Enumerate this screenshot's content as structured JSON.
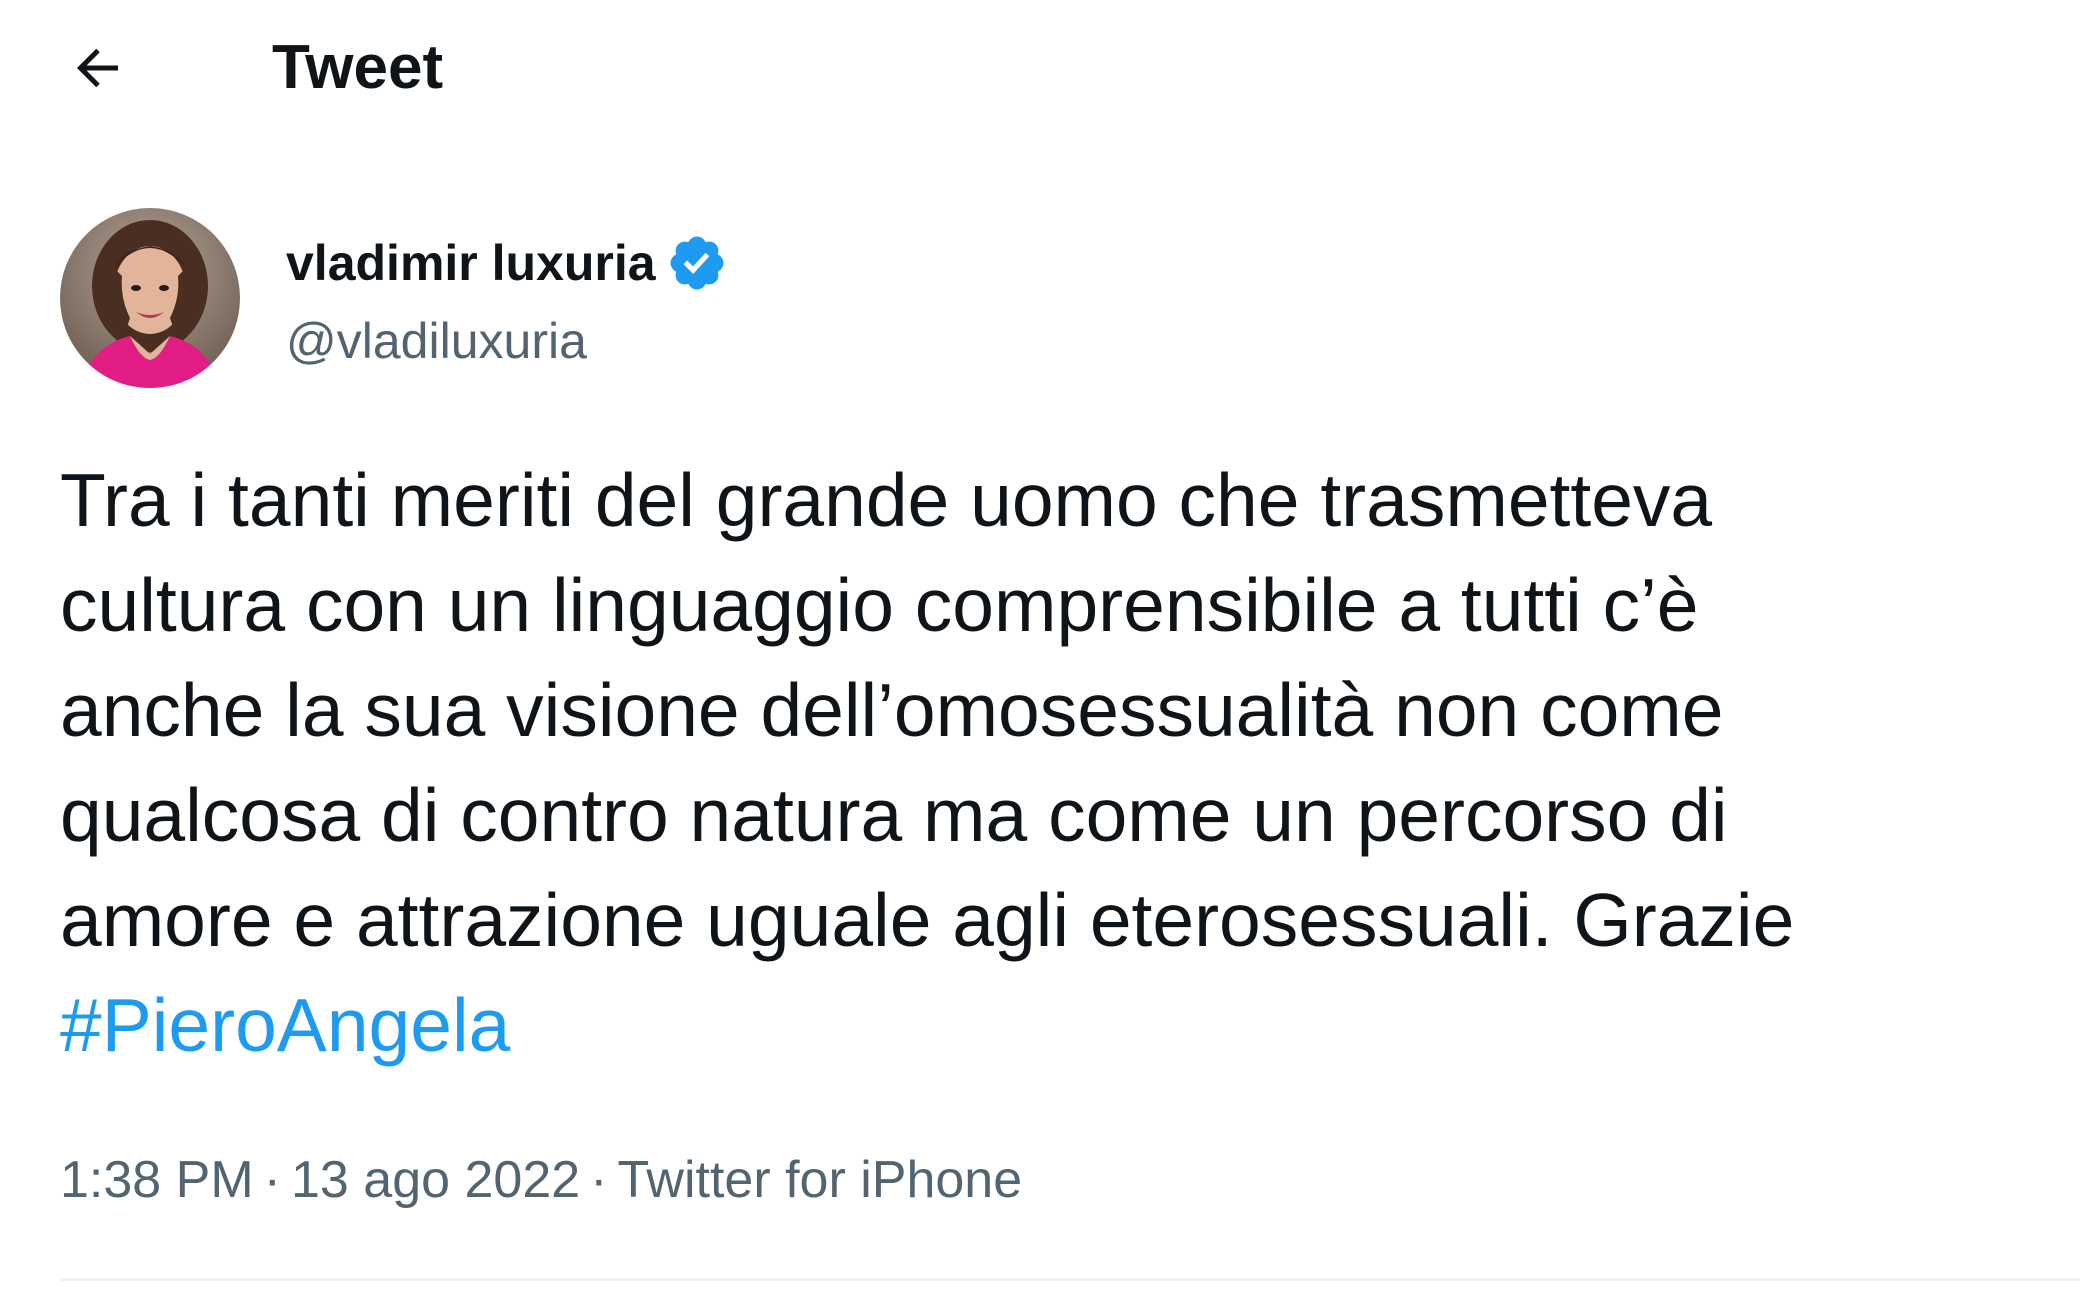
{
  "header": {
    "back_icon": "arrow-left-icon",
    "title": "Tweet"
  },
  "author": {
    "display_name": "vladimir luxuria",
    "verified_icon": "verified-badge-icon",
    "handle": "@vladiluxuria",
    "avatar_icon": "avatar"
  },
  "tweet": {
    "lines": [
      "Tra i tanti meriti del grande uomo che trasmetteva",
      "cultura con un linguaggio comprensibile a tutti c’è",
      "anche la sua visione dell’omosessualità non come",
      "qualcosa di contro natura ma come un percorso di",
      "amore e attrazione uguale agli eterosessuali. Grazie"
    ],
    "hashtag": "#PieroAngela"
  },
  "meta": {
    "time": "1:38 PM",
    "separator": "·",
    "date": "13 ago 2022",
    "source": "Twitter for iPhone"
  },
  "colors": {
    "text": "#0f1419",
    "secondary": "#536471",
    "accent": "#1d9bf0",
    "divider": "#eff3f4"
  }
}
